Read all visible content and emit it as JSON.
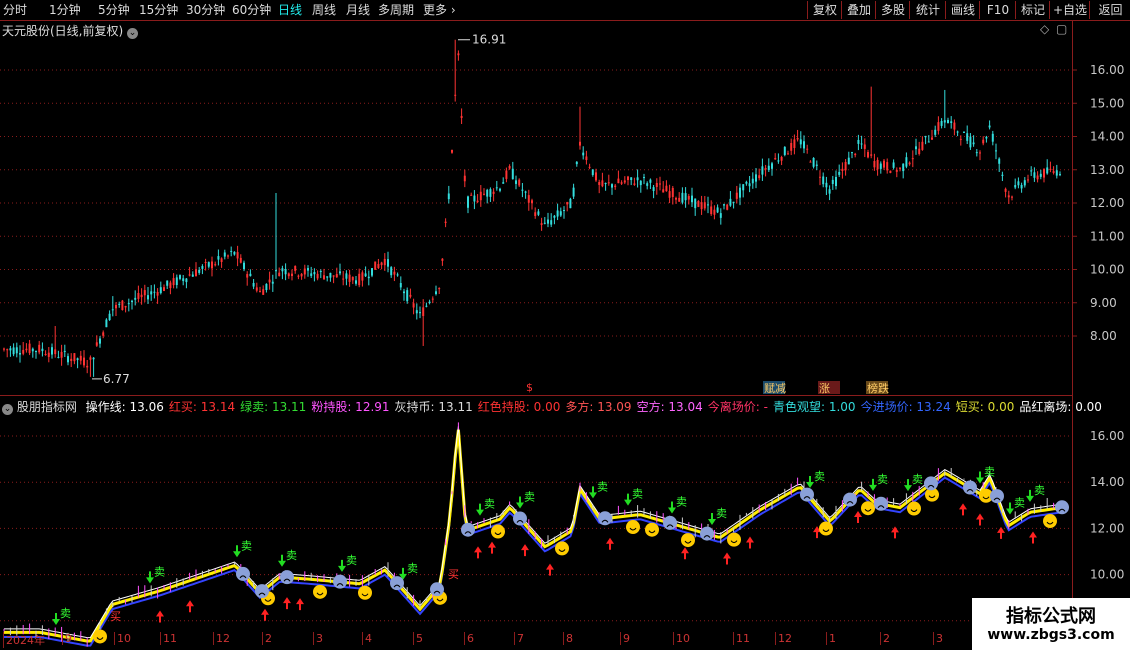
{
  "toolbar": {
    "periods": [
      "分时",
      "1分钟",
      "5分钟",
      "15分钟",
      "30分钟",
      "60分钟",
      "日线",
      "周线",
      "月线",
      "多周期"
    ],
    "active_period": "日线",
    "more_label": "更多",
    "right_buttons": [
      "复权",
      "叠加",
      "多股",
      "统计",
      "画线",
      "F10",
      "标记",
      "+自选",
      "返回"
    ]
  },
  "upper_chart": {
    "title": "天元股份(日线,前复权)",
    "high_label": "16.91",
    "low_label": "6.77",
    "y_ticks": [
      "16.00",
      "15.00",
      "14.00",
      "13.00",
      "12.00",
      "11.00",
      "10.00",
      "9.00",
      "8.00"
    ],
    "markers": {
      "dollar": "$",
      "tag1": "赋减",
      "tag2": "涨",
      "tag3": "榜跌"
    }
  },
  "lower_chart": {
    "title": "股朋指标网",
    "legend": [
      {
        "label": "操作线:",
        "value": "13.06",
        "color": "#ffffff"
      },
      {
        "label": "红买:",
        "value": "13.14",
        "color": "#ff3333"
      },
      {
        "label": "绿卖:",
        "value": "13.11",
        "color": "#33dd33"
      },
      {
        "label": "粉持股:",
        "value": "12.91",
        "color": "#ff55ff"
      },
      {
        "label": "灰持币:",
        "value": "13.11",
        "color": "#dddddd"
      },
      {
        "label": "红色持股:",
        "value": "0.00",
        "color": "#ff3333"
      },
      {
        "label": "多方:",
        "value": "13.09",
        "color": "#ff5555"
      },
      {
        "label": "空方:",
        "value": "13.04",
        "color": "#ff66ff"
      },
      {
        "label": "今离场价:",
        "value": "-",
        "color": "#ff3366"
      },
      {
        "label": "青色观望:",
        "value": "1.00",
        "color": "#33dddd"
      },
      {
        "label": "今进场价:",
        "value": "13.24",
        "color": "#3366ff"
      },
      {
        "label": "短买:",
        "value": "0.00",
        "color": "#dddd33"
      },
      {
        "label": "品红离场:",
        "value": "0.00",
        "color": "#ffffff"
      }
    ],
    "y_ticks": [
      "16.00",
      "14.00",
      "12.00",
      "10.00",
      "8.00"
    ],
    "buy_label": "买",
    "sell_label": "卖"
  },
  "x_axis": {
    "labels": [
      "2024年",
      "9",
      "10",
      "11",
      "12",
      "2",
      "3",
      "4",
      "5",
      "6",
      "7",
      "8",
      "9",
      "10",
      "11",
      "12",
      "1",
      "2",
      "3"
    ]
  },
  "watermark": {
    "title": "指标公式网",
    "url": "www.zbgs3.com"
  },
  "colors": {
    "up": "#ff3333",
    "down": "#33dddd",
    "grid": "#8a1c1c"
  }
}
